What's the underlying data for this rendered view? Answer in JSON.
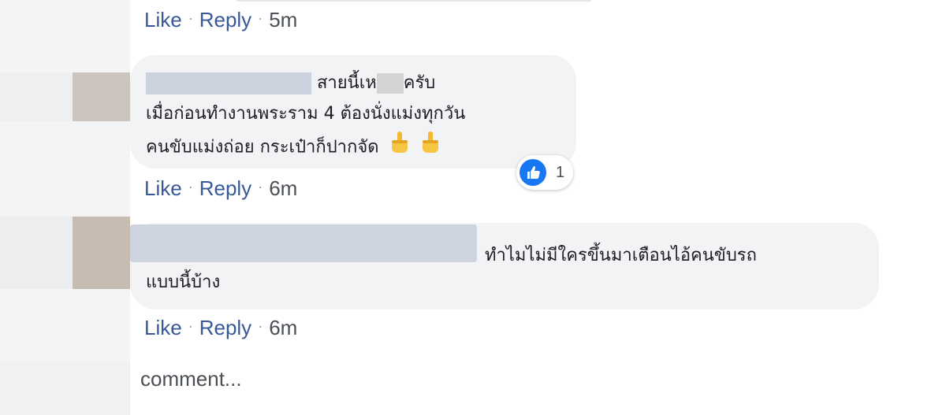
{
  "comments": [
    {
      "actions": {
        "like": "Like",
        "reply": "Reply",
        "dot": "·",
        "time": "5m"
      }
    },
    {
      "text_line1": "สายนี้เห",
      "text_line1_end": "ครับ",
      "text_line2": "เมื่อก่อนทำงานพระราม 4 ต้องนั่งแม่งทุกวัน",
      "text_line3": "คนขับแม่งถ่อย กระเป๋าก็ปากจัด",
      "reactions": {
        "type": "like",
        "count": "1"
      },
      "actions": {
        "like": "Like",
        "reply": "Reply",
        "dot": "·",
        "time": "6m"
      }
    },
    {
      "text_line1": "ทำไมไม่มีใครขึ้นมาเตือนไอ้คนขับรถ",
      "text_line2": "แบบนี้บ้าง",
      "actions": {
        "like": "Like",
        "reply": "Reply",
        "dot": "·",
        "time": "6m"
      }
    }
  ],
  "composer": {
    "placeholder": "comment..."
  },
  "colors": {
    "link": "#385898",
    "bubble": "#f2f3f5",
    "like_blue": "#1877f2"
  }
}
